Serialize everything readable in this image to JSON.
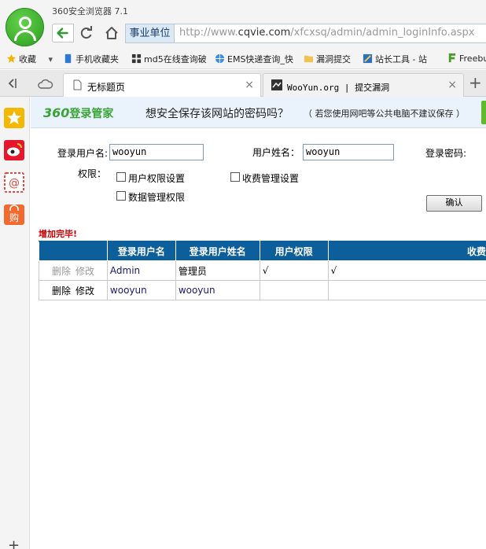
{
  "browser": {
    "title": "360安全浏览器 7.1",
    "cert_badge": "事业单位",
    "url_prefix": "http://www.",
    "url_domain": "cqvie.com",
    "url_path": "/xfcxsq/admin/admin_loginInfo.aspx"
  },
  "favorites": [
    {
      "label": "收藏"
    },
    {
      "label": "手机收藏夹"
    },
    {
      "label": "md5在线查询破"
    },
    {
      "label": "EMS快递查询_快"
    },
    {
      "label": "漏洞提交"
    },
    {
      "label": "站长工具 - 站"
    },
    {
      "label": "Freebu"
    }
  ],
  "tabs": [
    {
      "label": "无标题页",
      "active": true
    },
    {
      "label": "WooYun.org | 提交漏洞",
      "active": false
    }
  ],
  "password_bar": {
    "brand_num": "360",
    "brand_text": "登录管家",
    "question": "想安全保存该网站的密码吗？",
    "hint": "（ 若您使用网吧等公共电脑不建议保存 ）"
  },
  "form": {
    "login_name_label": "登录用户名:",
    "login_name_value": "wooyun",
    "user_name_label": "用户姓名：",
    "user_name_value": "wooyun",
    "password_label": "登录密码:",
    "perm_label": "权限：",
    "perms": [
      {
        "label": "用户权限设置",
        "checked": false
      },
      {
        "label": "收费管理设置",
        "checked": false
      },
      {
        "label": "数据管理权限",
        "checked": false
      }
    ],
    "confirm_label": "确认"
  },
  "message": "增加完毕!",
  "table": {
    "headers": [
      "",
      "登录用户名",
      "登录用户姓名",
      "用户权限",
      "收费"
    ],
    "rows": [
      {
        "delete": "删除",
        "edit": "修改",
        "login": "Admin",
        "name": "管理员",
        "perm": "√",
        "fee": "√"
      },
      {
        "delete": "删除",
        "edit": "修改",
        "login": "wooyun",
        "name": "wooyun",
        "perm": "",
        "fee": ""
      }
    ]
  },
  "colors": {
    "table_header": "#0c5f9b",
    "brand_green": "#3aa336",
    "message_red": "#cc0000"
  }
}
